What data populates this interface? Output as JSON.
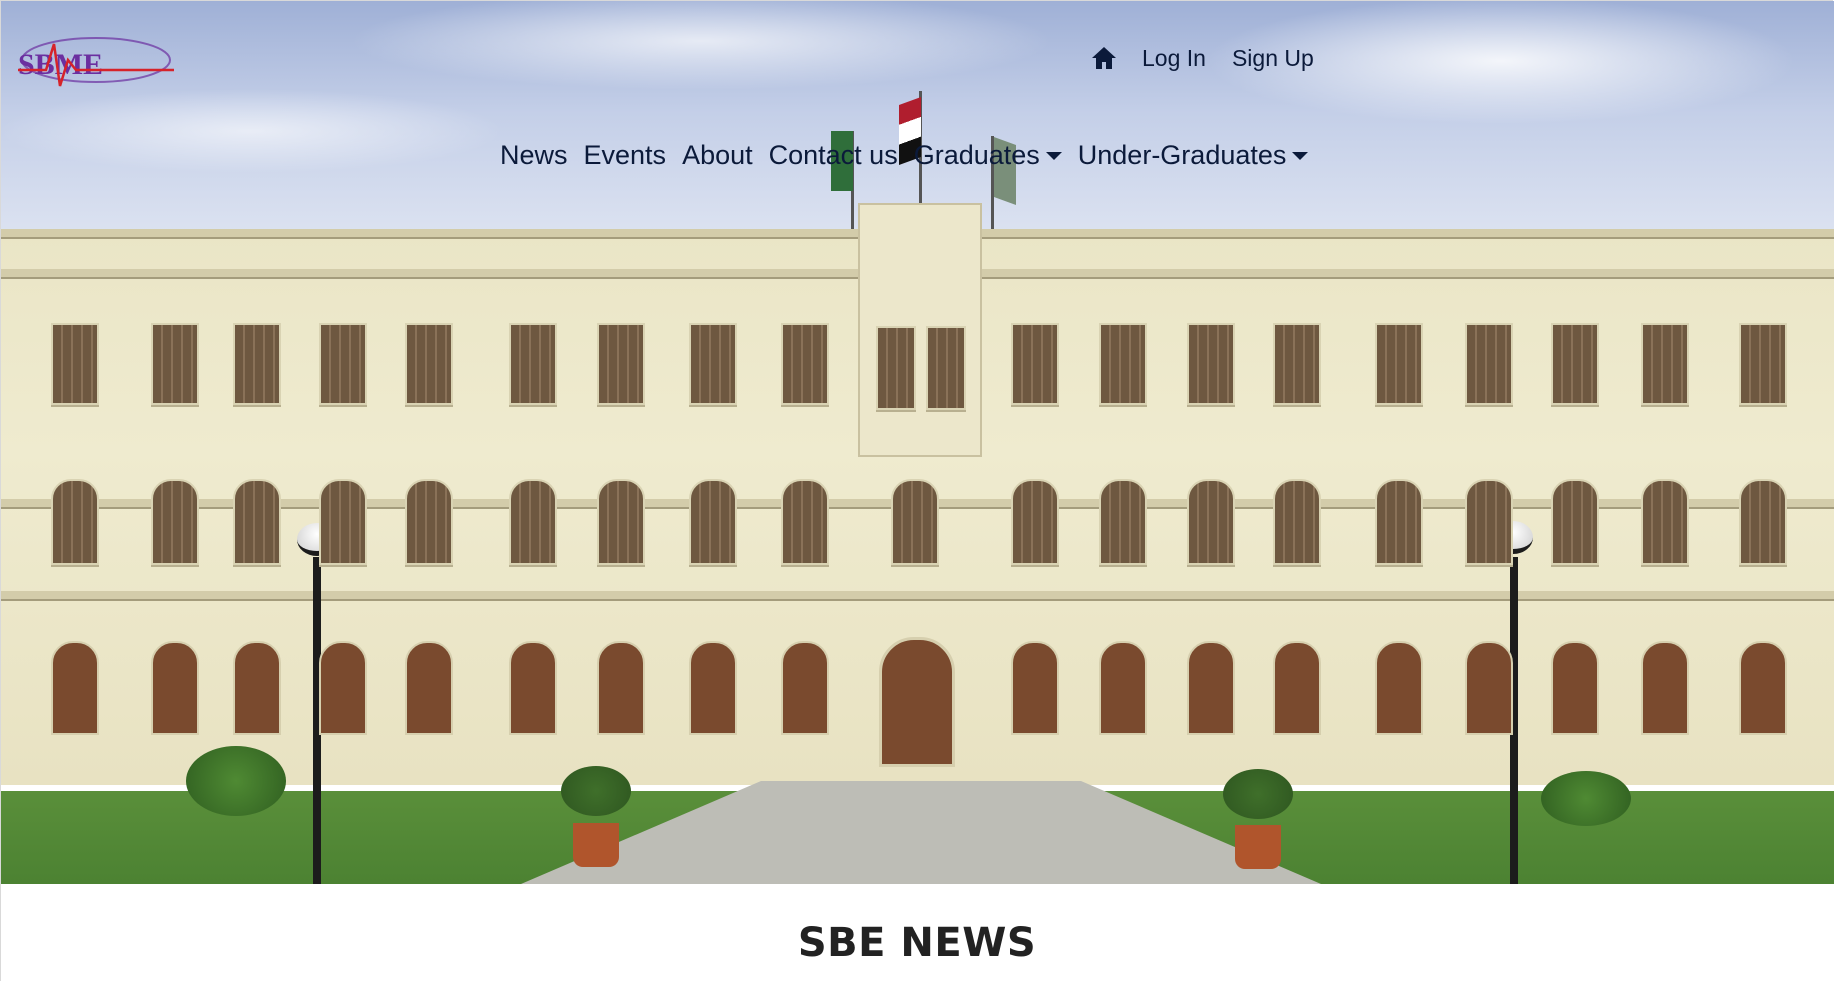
{
  "brand": {
    "logo_text": "SBME"
  },
  "top_nav": {
    "home_icon": "home-icon",
    "login_label": "Log In",
    "signup_label": "Sign Up"
  },
  "main_nav": {
    "items": [
      {
        "label": "News"
      },
      {
        "label": "Events"
      },
      {
        "label": "About"
      },
      {
        "label": "Contact us"
      },
      {
        "label": "Graduates",
        "dropdown": true
      },
      {
        "label": "Under-Graduates",
        "dropdown": true
      }
    ]
  },
  "hero": {
    "image": "faculty-building-photo"
  },
  "news_section": {
    "title": "SBE NEWS"
  },
  "colors": {
    "nav_text": "#0b1a3a",
    "heading": "#222222",
    "logo_purple": "#6b2fa0",
    "logo_red": "#d6232a"
  }
}
